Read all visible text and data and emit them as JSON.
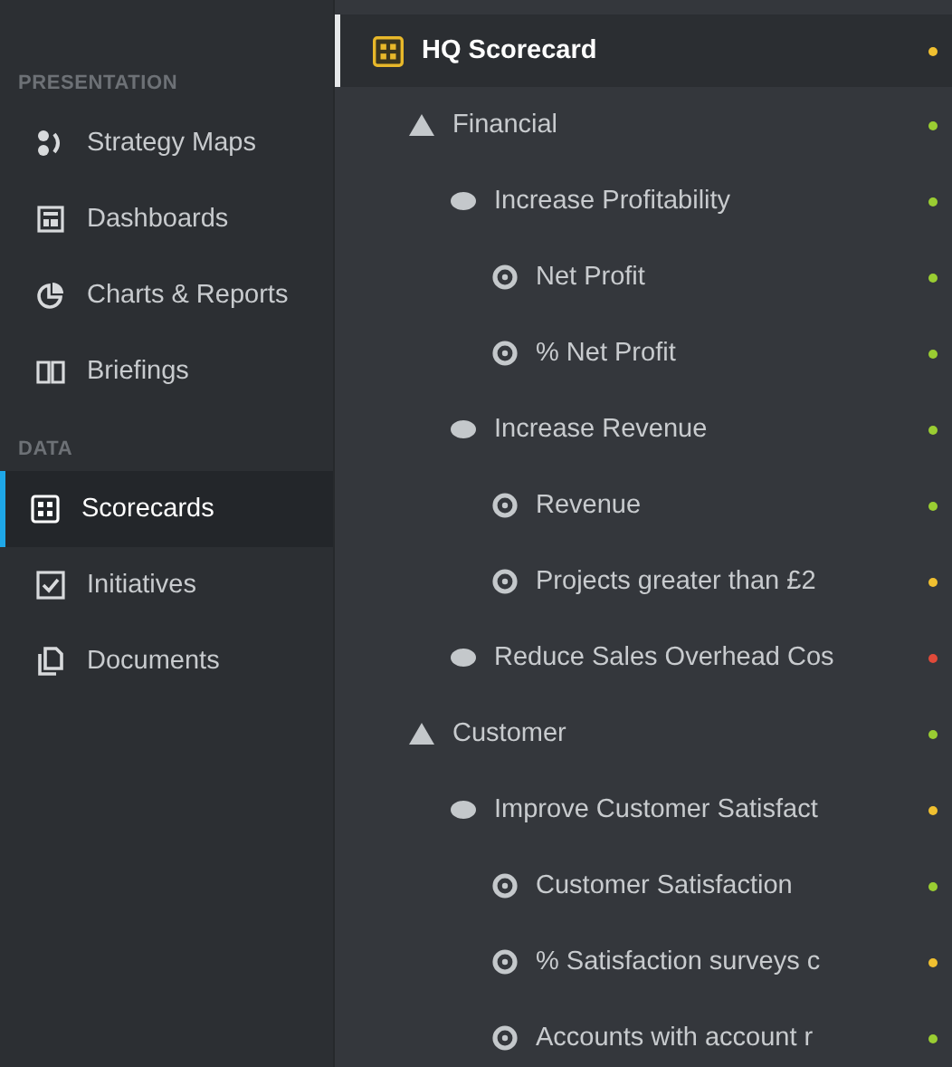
{
  "sidebar": {
    "sections": [
      {
        "title": "PRESENTATION",
        "items": [
          {
            "label": "Strategy Maps",
            "kind": "strategy-map",
            "selected": false
          },
          {
            "label": "Dashboards",
            "kind": "dashboard",
            "selected": false
          },
          {
            "label": "Charts & Reports",
            "kind": "chart",
            "selected": false
          },
          {
            "label": "Briefings",
            "kind": "book",
            "selected": false
          }
        ]
      },
      {
        "title": "DATA",
        "items": [
          {
            "label": "Scorecards",
            "kind": "scorecard",
            "selected": true
          },
          {
            "label": "Initiatives",
            "kind": "checkbox",
            "selected": false
          },
          {
            "label": "Documents",
            "kind": "documents",
            "selected": false
          }
        ]
      }
    ]
  },
  "tree": {
    "kind": "scorecard",
    "label": "HQ Scorecard",
    "color": "#f0c030",
    "children": [
      {
        "kind": "perspective",
        "label": "Financial",
        "color": "#9acd32",
        "children": [
          {
            "kind": "objective",
            "label": "Increase Profitability",
            "color": "#9acd32",
            "children": [
              {
                "kind": "measure",
                "label": "Net Profit",
                "color": "#9acd32"
              },
              {
                "kind": "measure",
                "label": "% Net Profit",
                "color": "#9acd32"
              }
            ]
          },
          {
            "kind": "objective",
            "label": "Increase Revenue",
            "color": "#9acd32",
            "children": [
              {
                "kind": "measure",
                "label": "Revenue",
                "color": "#9acd32"
              },
              {
                "kind": "measure",
                "label": "Projects greater than £2",
                "color": "#f0c030"
              }
            ]
          },
          {
            "kind": "objective",
            "label": "Reduce Sales Overhead Cos",
            "color": "#e04a3a"
          }
        ]
      },
      {
        "kind": "perspective",
        "label": "Customer",
        "color": "#9acd32",
        "children": [
          {
            "kind": "objective",
            "label": "Improve Customer Satisfact",
            "color": "#f0c030",
            "children": [
              {
                "kind": "measure",
                "label": "Customer Satisfaction",
                "color": "#9acd32"
              },
              {
                "kind": "measure",
                "label": "% Satisfaction surveys c",
                "color": "#f0c030"
              },
              {
                "kind": "measure",
                "label": "Accounts with account r",
                "color": "#9acd32"
              }
            ]
          }
        ]
      }
    ]
  }
}
